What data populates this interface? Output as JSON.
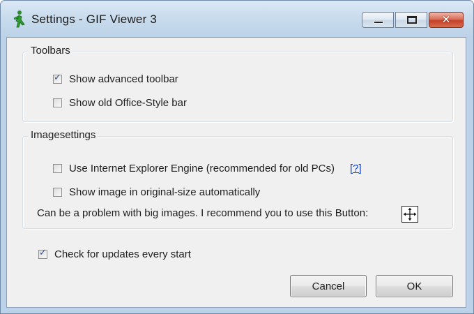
{
  "window": {
    "title": "Settings - GIF Viewer 3",
    "app_icon": "running-man-icon",
    "controls": {
      "minimize": "minimize-icon",
      "maximize": "maximize-icon",
      "close_glyph": "✕"
    }
  },
  "toolbars": {
    "label": "Toolbars",
    "options": [
      {
        "label": "Show advanced toolbar",
        "checked": true
      },
      {
        "label": "Show old Office-Style bar",
        "checked": false
      }
    ]
  },
  "imagesettings": {
    "label": "Imagesettings",
    "options": [
      {
        "label": "Use Internet Explorer Engine (recommended for old PCs)",
        "checked": false
      },
      {
        "label": "Show image in original-size automatically",
        "checked": false
      }
    ],
    "help_link": "[?]",
    "note": "Can be a problem with big images. I recommend you to use this Button:",
    "note_button_icon": "move-arrows-icon"
  },
  "updates": {
    "label": "Check for updates every start",
    "checked": true
  },
  "buttons": {
    "cancel": "Cancel",
    "ok": "OK"
  },
  "colors": {
    "link": "#0b44d8",
    "close_button": "#c53f28",
    "titlebar": "#c9dced",
    "dialog_bg": "#f0f0f0"
  }
}
